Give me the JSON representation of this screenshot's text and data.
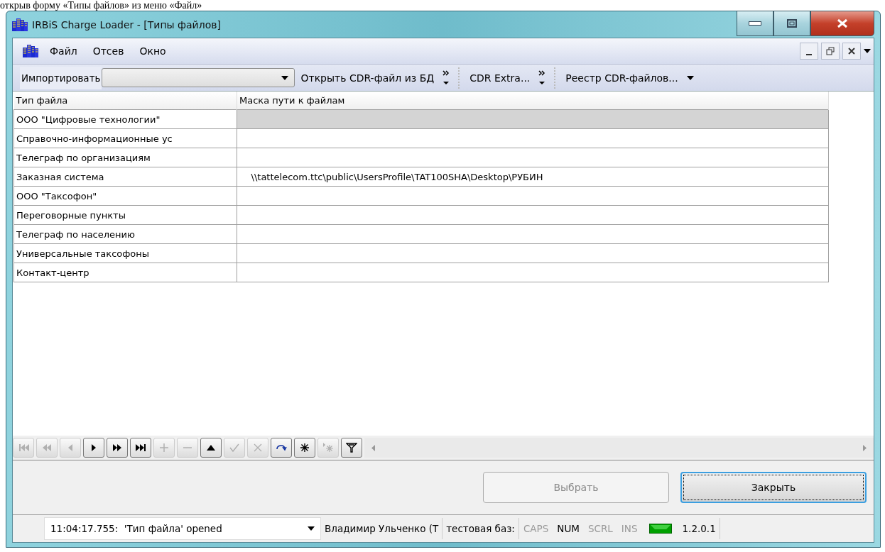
{
  "caption": "открыв форму «Типы файлов» из меню «Файл»",
  "window": {
    "title": "IRBiS Charge Loader - [Типы файлов]"
  },
  "menu": [
    "Файл",
    "Отсев",
    "Окно"
  ],
  "toolbar": {
    "import_label": "Импортировать",
    "buttons": [
      {
        "label": "Открыть CDR-файл из БД",
        "more": true
      },
      {
        "label": "CDR Extra...",
        "more": true
      },
      {
        "label": "Реестр CDR-файлов...",
        "more": false
      }
    ]
  },
  "table": {
    "columns": [
      "Тип файла",
      "Маска пути к файлам"
    ],
    "rows": [
      {
        "cells": [
          "ООО \"Цифровые технологии\"",
          ""
        ],
        "selected": true
      },
      {
        "cells": [
          "Справочно-информационные ус",
          ""
        ],
        "selected": false
      },
      {
        "cells": [
          "Телеграф по организациям",
          ""
        ],
        "selected": false
      },
      {
        "cells": [
          "Заказная система",
          "    \\\\tattelecom.ttc\\public\\UsersProfile\\TAT100SHA\\Desktop\\РУБИН"
        ],
        "selected": false
      },
      {
        "cells": [
          "ООО \"Таксофон\"",
          ""
        ],
        "selected": false
      },
      {
        "cells": [
          "Переговорные пункты",
          ""
        ],
        "selected": false
      },
      {
        "cells": [
          "Телеграф по населению",
          ""
        ],
        "selected": false
      },
      {
        "cells": [
          "Универсальные таксофоны",
          ""
        ],
        "selected": false
      },
      {
        "cells": [
          "Контакт-центр",
          ""
        ],
        "selected": false
      }
    ]
  },
  "navigator": [
    {
      "kind": "first",
      "disabled": true
    },
    {
      "kind": "prior_page",
      "disabled": true
    },
    {
      "kind": "prior",
      "disabled": true
    },
    {
      "kind": "next",
      "disabled": false
    },
    {
      "kind": "next_page",
      "disabled": false
    },
    {
      "kind": "last",
      "disabled": false
    },
    {
      "kind": "insert",
      "disabled": true
    },
    {
      "kind": "delete",
      "disabled": true
    },
    {
      "kind": "edit",
      "disabled": false
    },
    {
      "kind": "post",
      "disabled": true
    },
    {
      "kind": "cancel",
      "disabled": true
    },
    {
      "kind": "refresh",
      "disabled": false
    },
    {
      "kind": "star",
      "disabled": false
    },
    {
      "kind": "star_arrow",
      "disabled": true
    },
    {
      "kind": "filter",
      "disabled": false
    }
  ],
  "buttons": [
    {
      "label": "Выбрать",
      "disabled": true,
      "default": false
    },
    {
      "label": "Закрыть",
      "disabled": false,
      "default": true
    }
  ],
  "status_bar": {
    "log": "11:04:17.755:  'Тип файла' opened",
    "user": "Владимир Ульченко (Т",
    "database": "тестовая баз:",
    "indicators": [
      {
        "label": "CAPS",
        "on": false
      },
      {
        "label": "NUM",
        "on": true
      },
      {
        "label": "SCRL",
        "on": false
      },
      {
        "label": "INS",
        "on": false
      }
    ],
    "version": "1.2.0.1"
  }
}
